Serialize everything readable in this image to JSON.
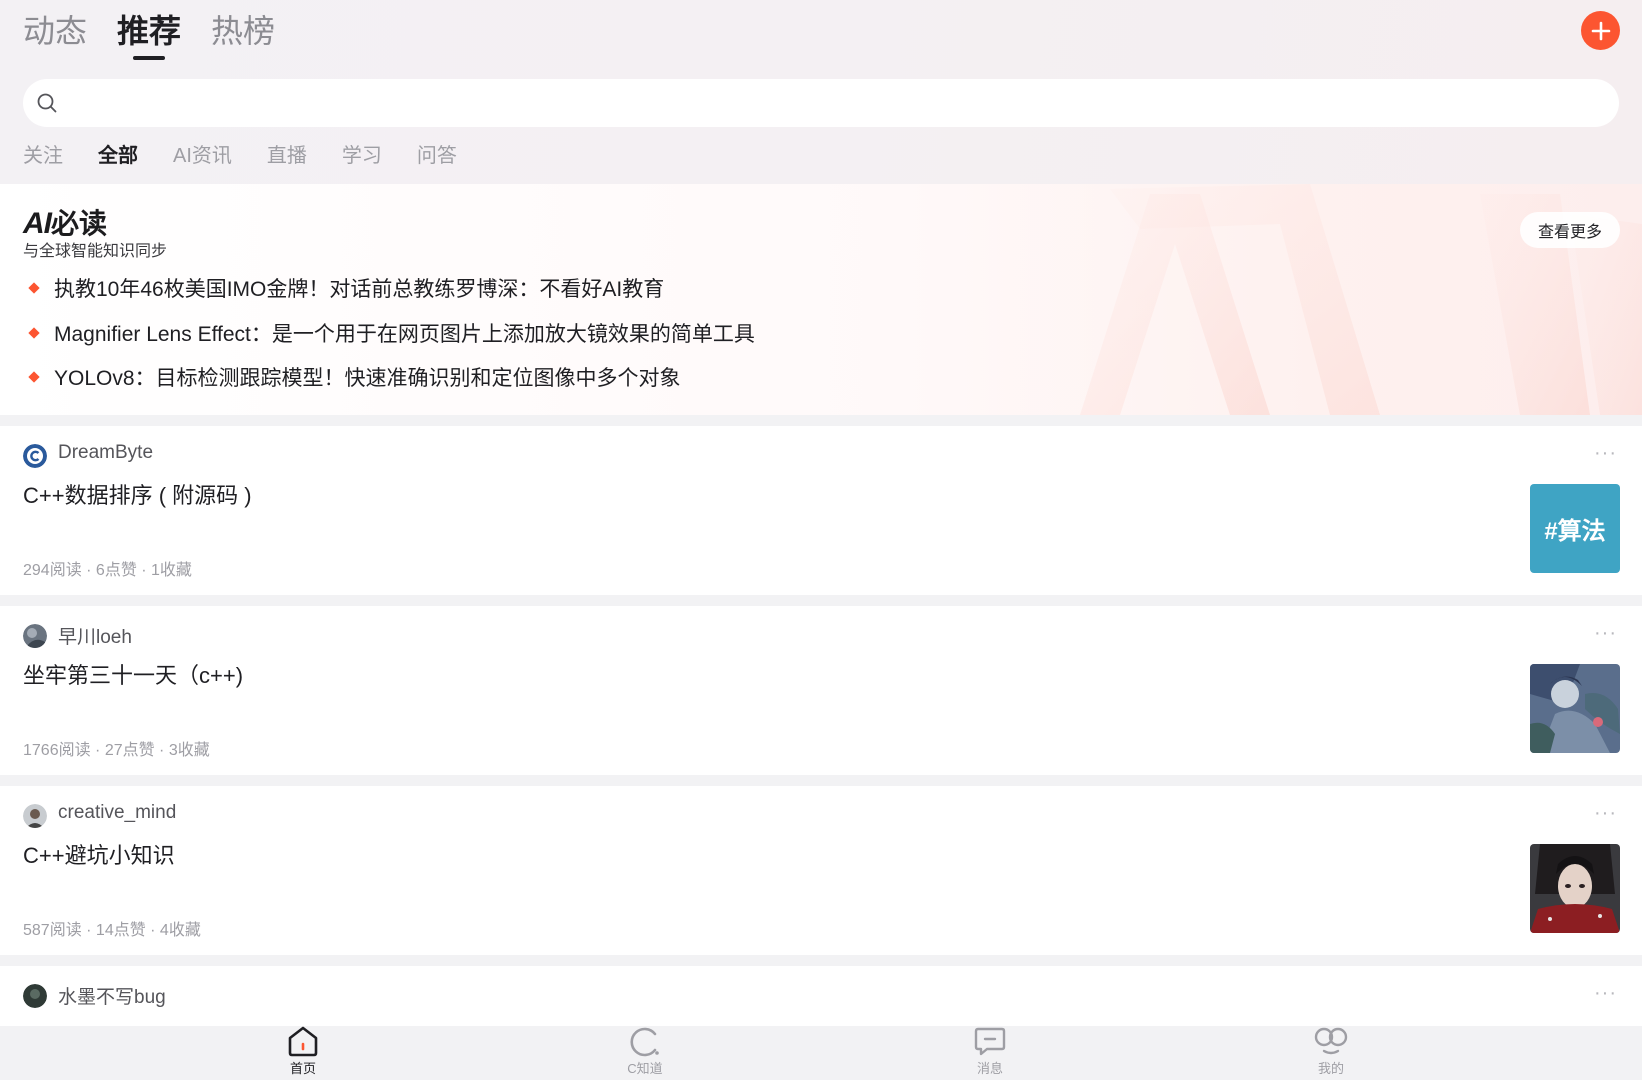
{
  "top_tabs": [
    "动态",
    "推荐",
    "热榜"
  ],
  "active_top_tab": 1,
  "search": {
    "placeholder": ""
  },
  "category_tabs": [
    "关注",
    "全部",
    "AI资讯",
    "直播",
    "学习",
    "问答"
  ],
  "ai_section": {
    "logo_ai": "AI",
    "logo_cn": "必读",
    "subtitle": "与全球智能知识同步",
    "more_label": "查看更多",
    "items": [
      "执教10年46枚美国IMO金牌！对话前总教练罗博深：不看好AI教育",
      "Magnifier Lens Effect：是一个用于在网页图片上添加放大镜效果的简单工具",
      "YOLOv8：目标检测跟踪模型！快速准确识别和定位图像中多个对象"
    ]
  },
  "feed": [
    {
      "author": "DreamByte",
      "title": "C++数据排序 ( 附源码 )",
      "stats": "294阅读 · 6点赞 · 1收藏",
      "thumb_tag": "#算法",
      "avatar_icon": "c-logo-avatar"
    },
    {
      "author": "早川loeh",
      "title": "坐牢第三十一天（c++)",
      "stats": "1766阅读 · 27点赞 · 3收藏",
      "thumb_tag": "",
      "avatar_icon": "user-avatar"
    },
    {
      "author": "creative_mind",
      "title": "C++避坑小知识",
      "stats": "587阅读 · 14点赞 · 4收藏",
      "thumb_tag": "",
      "avatar_icon": "user-avatar"
    },
    {
      "author": "水墨不写bug",
      "title": "",
      "stats": "",
      "thumb_tag": "",
      "avatar_icon": "user-avatar"
    }
  ],
  "more_dots": "···",
  "bottom_nav": [
    {
      "label": "首页",
      "icon": "home-icon"
    },
    {
      "label": "C知道",
      "icon": "c-know-icon"
    },
    {
      "label": "消息",
      "icon": "message-icon"
    },
    {
      "label": "我的",
      "icon": "profile-icon"
    }
  ],
  "colors": {
    "accent": "#fc5531",
    "tag_bg": "#3fa4c4"
  }
}
